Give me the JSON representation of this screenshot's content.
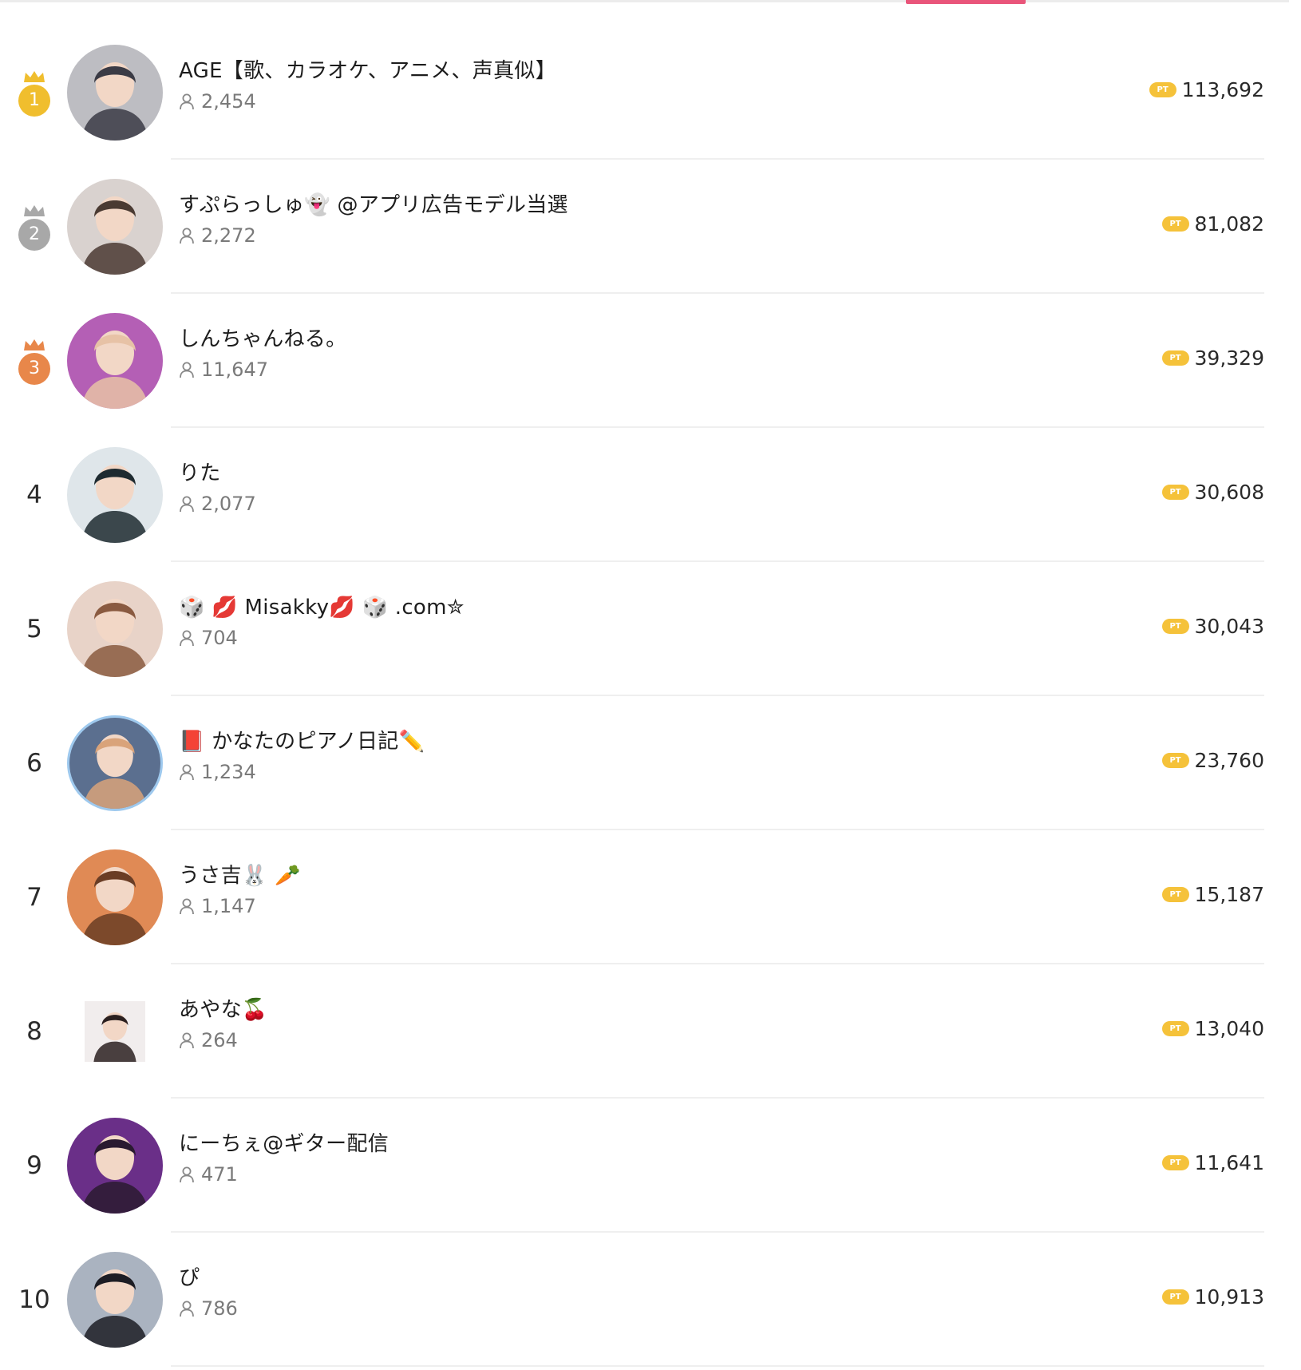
{
  "colors": {
    "accent": "#e9557a",
    "gold": "#f0be2e",
    "silver": "#a8a8a8",
    "bronze": "#e8874a",
    "pt_badge": "#f5c23a"
  },
  "pt_label": "PT",
  "rankings": [
    {
      "rank": "1",
      "name": "AGE【歌、カラオケ、アニメ、声真似】",
      "followers": "2,454",
      "points": "113,692",
      "medal": "gold",
      "avatar_bg": "#bdbdc2",
      "avatar_fg": "#3b3b45"
    },
    {
      "rank": "2",
      "name": "すぷらっしゅ👻 @アプリ広告モデル当選",
      "followers": "2,272",
      "points": "81,082",
      "medal": "silver",
      "avatar_bg": "#d9d2cf",
      "avatar_fg": "#4a3a32"
    },
    {
      "rank": "3",
      "name": "しんちゃんねる。",
      "followers": "11,647",
      "points": "39,329",
      "medal": "bronze",
      "avatar_bg": "#b45fb5",
      "avatar_fg": "#e7c2a6"
    },
    {
      "rank": "4",
      "name": "りた",
      "followers": "2,077",
      "points": "30,608",
      "medal": "",
      "avatar_bg": "#dfe6ea",
      "avatar_fg": "#1e2a30"
    },
    {
      "rank": "5",
      "name": "🎲 💋 Misakky💋 🎲 .com✮",
      "followers": "704",
      "points": "30,043",
      "medal": "",
      "avatar_bg": "#e8d3c8",
      "avatar_fg": "#8a5a40"
    },
    {
      "rank": "6",
      "name": "📕 かなたのピアノ日記✏️",
      "followers": "1,234",
      "points": "23,760",
      "medal": "",
      "avatar_bg": "#5b6f8f",
      "avatar_fg": "#d9a37a"
    },
    {
      "rank": "7",
      "name": "うさ吉🐰 🥕",
      "followers": "1,147",
      "points": "15,187",
      "medal": "",
      "avatar_bg": "#e08a55",
      "avatar_fg": "#6a3d25"
    },
    {
      "rank": "8",
      "name": "あやな🍒",
      "followers": "264",
      "points": "13,040",
      "medal": "",
      "avatar_bg": "#f1eded",
      "avatar_fg": "#2b2020"
    },
    {
      "rank": "9",
      "name": "にーちぇ@ギター配信",
      "followers": "471",
      "points": "11,641",
      "medal": "",
      "avatar_bg": "#6a2f88",
      "avatar_fg": "#2a1a30"
    },
    {
      "rank": "10",
      "name": "ぴ",
      "followers": "786",
      "points": "10,913",
      "medal": "",
      "avatar_bg": "#aab3c0",
      "avatar_fg": "#1d1d24"
    }
  ]
}
